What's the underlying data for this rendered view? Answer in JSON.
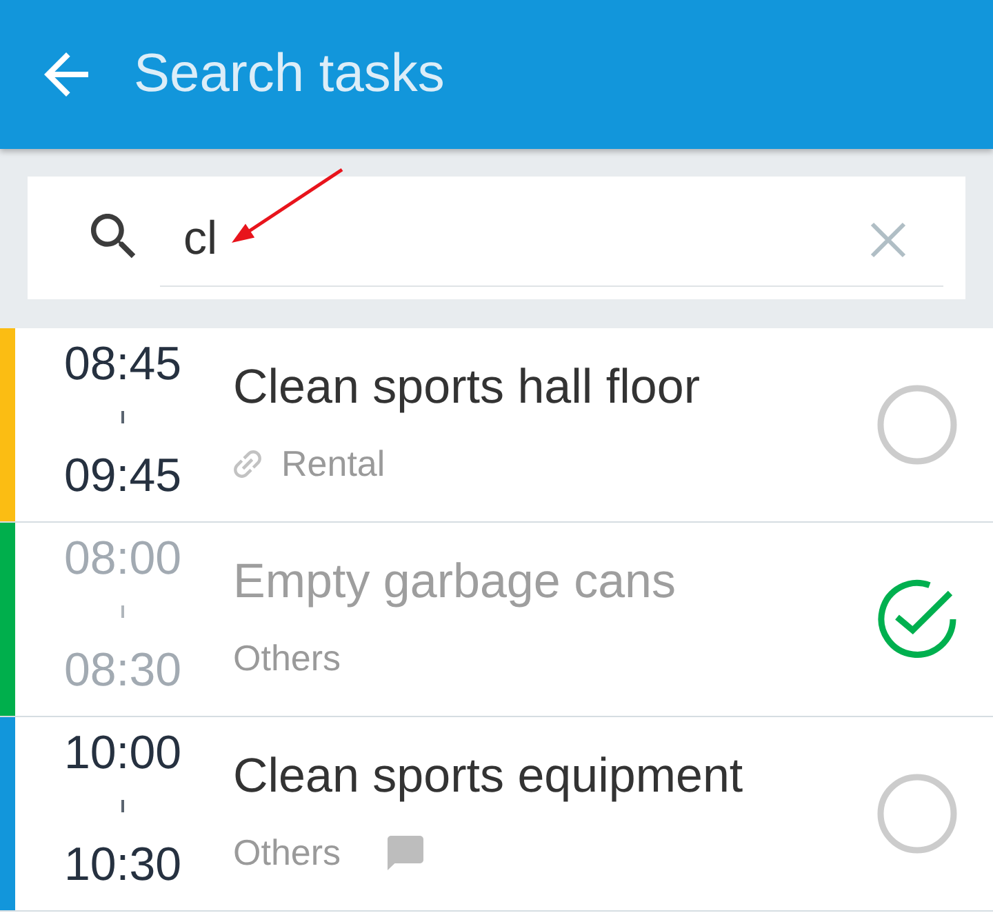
{
  "header": {
    "title": "Search tasks"
  },
  "search": {
    "value": "cl"
  },
  "tasks": [
    {
      "start": "08:45",
      "end": "09:45",
      "title": "Clean sports hall floor",
      "category": "Rental",
      "linked": true,
      "has_comment": false,
      "done": false,
      "color": "#fbbd13"
    },
    {
      "start": "08:00",
      "end": "08:30",
      "title": "Empty garbage cans",
      "category": "Others",
      "linked": false,
      "has_comment": false,
      "done": true,
      "color": "#00af4c"
    },
    {
      "start": "10:00",
      "end": "10:30",
      "title": "Clean sports equipment",
      "category": "Others",
      "linked": false,
      "has_comment": true,
      "done": false,
      "color": "#1296db"
    }
  ]
}
